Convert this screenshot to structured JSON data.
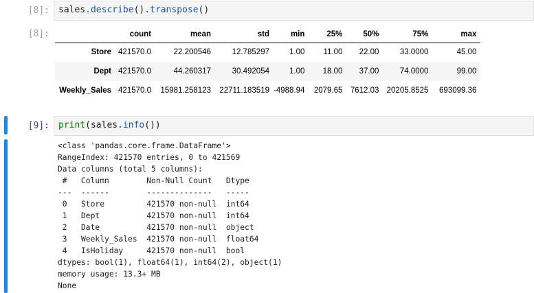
{
  "cell8": {
    "in_prompt": "[8]:",
    "out_prompt": "[8]:",
    "code": {
      "var": "sales",
      "method1": ".describe",
      "paren1": "()",
      "method2": ".transpose",
      "paren2": "()"
    },
    "table": {
      "columns": [
        "count",
        "mean",
        "std",
        "min",
        "25%",
        "50%",
        "75%",
        "max"
      ],
      "rows": [
        {
          "index": "Store",
          "values": [
            "421570.0",
            "22.200546",
            "12.785297",
            "1.00",
            "11.00",
            "22.00",
            "33.0000",
            "45.00"
          ]
        },
        {
          "index": "Dept",
          "values": [
            "421570.0",
            "44.260317",
            "30.492054",
            "1.00",
            "18.00",
            "37.00",
            "74.0000",
            "99.00"
          ]
        },
        {
          "index": "Weekly_Sales",
          "values": [
            "421570.0",
            "15981.258123",
            "22711.183519",
            "-4988.94",
            "2079.65",
            "7612.03",
            "20205.8525",
            "693099.36"
          ]
        }
      ]
    }
  },
  "cell9": {
    "in_prompt": "[9]:",
    "code": {
      "builtin1": "print",
      "open": "(",
      "var": "sales",
      "method": ".info",
      "close": "())"
    },
    "output_lines": [
      "<class 'pandas.core.frame.DataFrame'>",
      "RangeIndex: 421570 entries, 0 to 421569",
      "Data columns (total 5 columns):",
      " #   Column        Non-Null Count   Dtype  ",
      "---  ------        --------------   -----  ",
      " 0   Store         421570 non-null  int64  ",
      " 1   Dept          421570 non-null  int64  ",
      " 2   Date          421570 non-null  object ",
      " 3   Weekly_Sales  421570 non-null  float64",
      " 4   IsHoliday     421570 non-null  bool   ",
      "dtypes: bool(1), float64(1), int64(2), object(1)",
      "memory usage: 13.3+ MB",
      "None"
    ]
  },
  "colors": {
    "selection_bar": "#1e88e5",
    "in_prompt": "#303f9f",
    "out_prompt": "#a0a0a0",
    "builtin": "#008000",
    "attribute": "#1a53a8"
  }
}
